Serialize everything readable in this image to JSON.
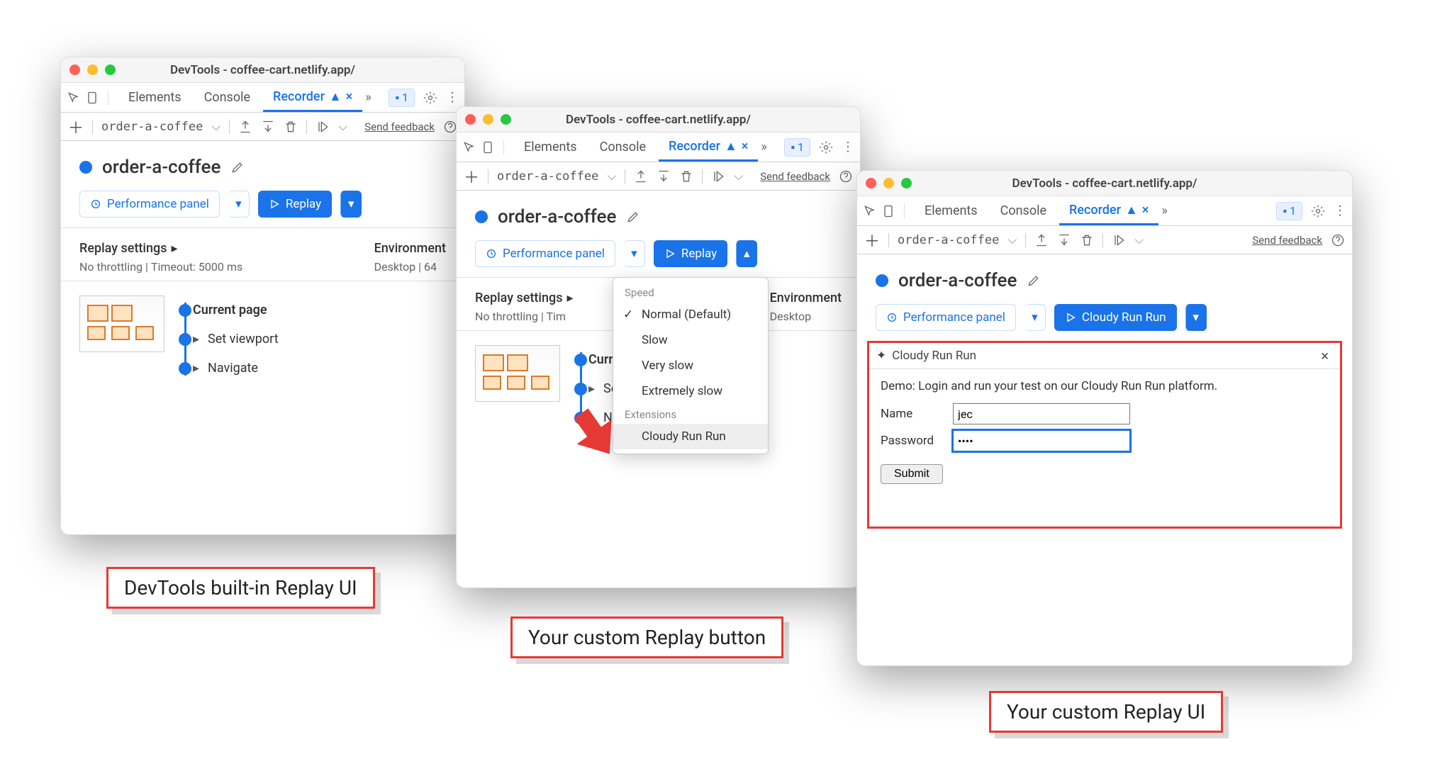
{
  "window_title": "DevTools - coffee-cart.netlify.app/",
  "tabs": {
    "elements": "Elements",
    "console": "Console",
    "recorder": "Recorder"
  },
  "issue_count": "1",
  "recording_name": "order-a-coffee",
  "send_feedback": "Send feedback",
  "rec_title": "order-a-coffee",
  "perf_panel": "Performance panel",
  "replay": "Replay",
  "replay_custom": "Cloudy Run Run",
  "settings": {
    "replay_hdr": "Replay settings",
    "throttle": "No throttling",
    "timeout": "Timeout: 5000 ms",
    "env_hdr": "Environment",
    "env1": "Desktop",
    "env2": "64"
  },
  "steps": [
    "Current page",
    "Set viewport",
    "Navigate"
  ],
  "dropdown": {
    "speed": "Speed",
    "normal": "Normal (Default)",
    "slow": "Slow",
    "veryslow": "Very slow",
    "extslow": "Extremely slow",
    "ext": "Extensions",
    "cloudy": "Cloudy Run Run"
  },
  "panel": {
    "title": "Cloudy Run Run",
    "desc": "Demo: Login and run your test on our Cloudy Run Run platform.",
    "name_label": "Name",
    "name_value": "jec",
    "pass_label": "Password",
    "pass_value": "••••",
    "submit": "Submit"
  },
  "captions": {
    "c1": "DevTools built-in Replay UI",
    "c2": "Your custom Replay button",
    "c3": "Your custom Replay UI"
  }
}
